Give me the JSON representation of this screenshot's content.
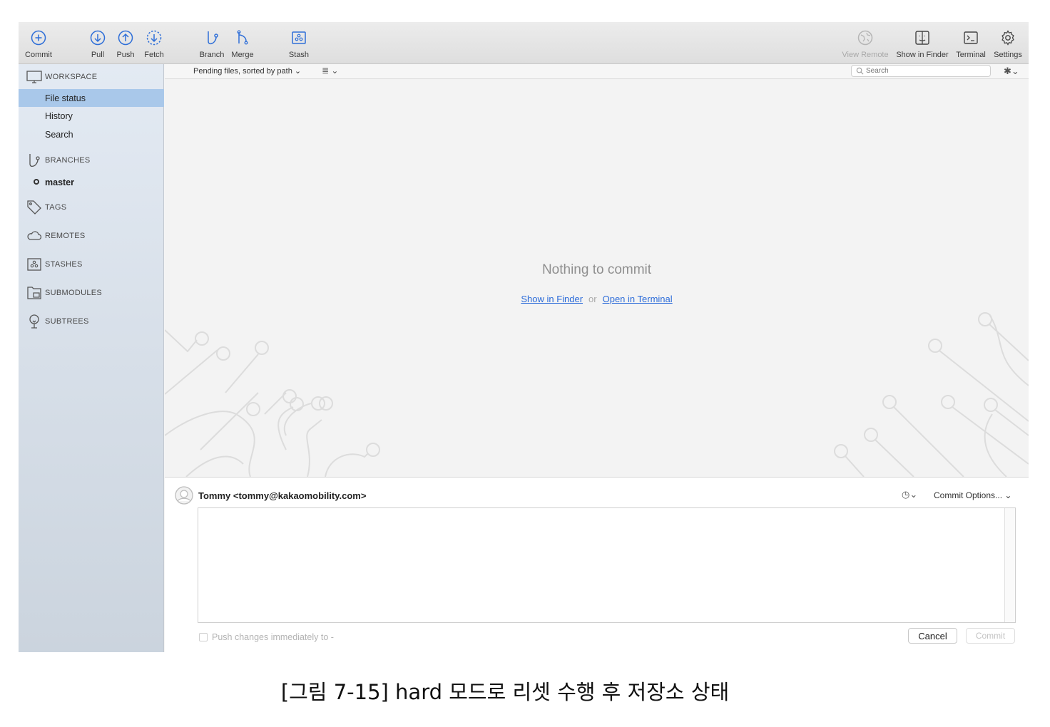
{
  "toolbar": {
    "commit": "Commit",
    "pull": "Pull",
    "push": "Push",
    "fetch": "Fetch",
    "branch": "Branch",
    "merge": "Merge",
    "stash": "Stash",
    "view_remote": "View Remote",
    "show_in_finder": "Show in Finder",
    "terminal": "Terminal",
    "settings": "Settings"
  },
  "sidebar": {
    "workspace": "WORKSPACE",
    "workspace_items": [
      "File status",
      "History",
      "Search"
    ],
    "selected_item": "File status",
    "branches": "BRANCHES",
    "current_branch": "master",
    "tags": "TAGS",
    "remotes": "REMOTES",
    "stashes": "STASHES",
    "submodules": "SUBMODULES",
    "subtrees": "SUBTREES"
  },
  "filterbar": {
    "sort_label": "Pending files, sorted by path",
    "search_placeholder": "Search"
  },
  "main": {
    "empty_message": "Nothing to commit",
    "show_in_finder": "Show in Finder",
    "or": "or",
    "open_in_terminal": "Open in Terminal"
  },
  "commit_panel": {
    "author": "Tommy <tommy@kakaomobility.com>",
    "options_label": "Commit Options...",
    "message": "",
    "push_label": "Push changes immediately to -",
    "push_checked": false,
    "cancel_label": "Cancel",
    "commit_label": "Commit"
  },
  "caption": "[그림 7-15] hard 모드로 리셋 수행 후 저장소 상태",
  "colors": {
    "accent": "#2b6bd9",
    "selection": "#a9c8ea",
    "toolbar_icon": "#2f6fd8"
  }
}
